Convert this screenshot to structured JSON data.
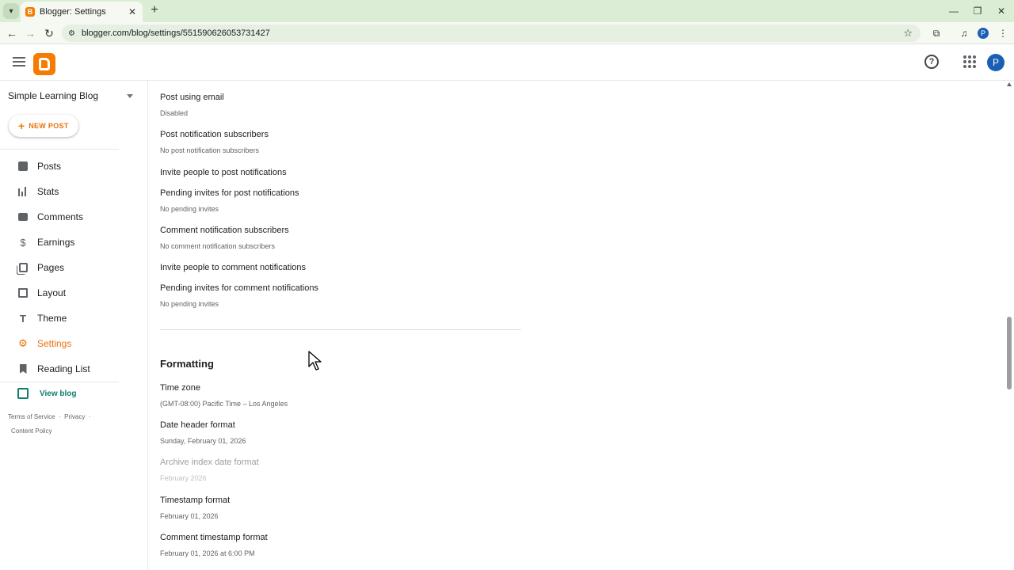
{
  "browser": {
    "tab_title": "Blogger: Settings",
    "favicon_letter": "B",
    "new_tab": "+",
    "url": "blogger.com/blog/settings/551590626053731427",
    "profile_initial": "P"
  },
  "header": {
    "help": "?",
    "avatar_initial": "P"
  },
  "sidebar": {
    "blog_name": "Simple Learning Blog",
    "new_post_label": "NEW POST",
    "items": [
      {
        "label": "Posts",
        "icon": "posts-icon"
      },
      {
        "label": "Stats",
        "icon": "stats-icon"
      },
      {
        "label": "Comments",
        "icon": "comments-icon"
      },
      {
        "label": "Earnings",
        "icon": "dollar-icon"
      },
      {
        "label": "Pages",
        "icon": "pages-icon"
      },
      {
        "label": "Layout",
        "icon": "layout-icon"
      },
      {
        "label": "Theme",
        "icon": "theme-icon"
      },
      {
        "label": "Settings",
        "icon": "gear-icon"
      },
      {
        "label": "Reading List",
        "icon": "bookmark-icon"
      }
    ],
    "view_blog": "View blog",
    "footer": {
      "terms": "Terms of Service",
      "privacy": "Privacy",
      "content_policy": "Content Policy"
    }
  },
  "main": {
    "settings": [
      {
        "label": "Post using email",
        "value": "Disabled"
      },
      {
        "label": "Post notification subscribers",
        "value": "No post notification subscribers"
      },
      {
        "label": "Invite people to post notifications",
        "value": ""
      },
      {
        "label": "Pending invites for post notifications",
        "value": "No pending invites"
      },
      {
        "label": "Comment notification subscribers",
        "value": "No comment notification subscribers"
      },
      {
        "label": "Invite people to comment notifications",
        "value": ""
      },
      {
        "label": "Pending invites for comment notifications",
        "value": "No pending invites"
      }
    ],
    "formatting": {
      "title": "Formatting",
      "settings": [
        {
          "label": "Time zone",
          "value": "(GMT-08:00) Pacific Time – Los Angeles"
        },
        {
          "label": "Date header format",
          "value": "Sunday, February 01, 2026"
        },
        {
          "label": "Archive index date format",
          "value": "February 2026"
        },
        {
          "label": "Timestamp format",
          "value": "February 01, 2026"
        },
        {
          "label": "Comment timestamp format",
          "value": "February 01, 2026 at 6:00 PM"
        }
      ]
    }
  },
  "colors": {
    "accent": "#e8710a",
    "blogger_orange": "#f57c00",
    "link_green": "#0f7e6f",
    "tab_bar": "#dcedd5"
  }
}
